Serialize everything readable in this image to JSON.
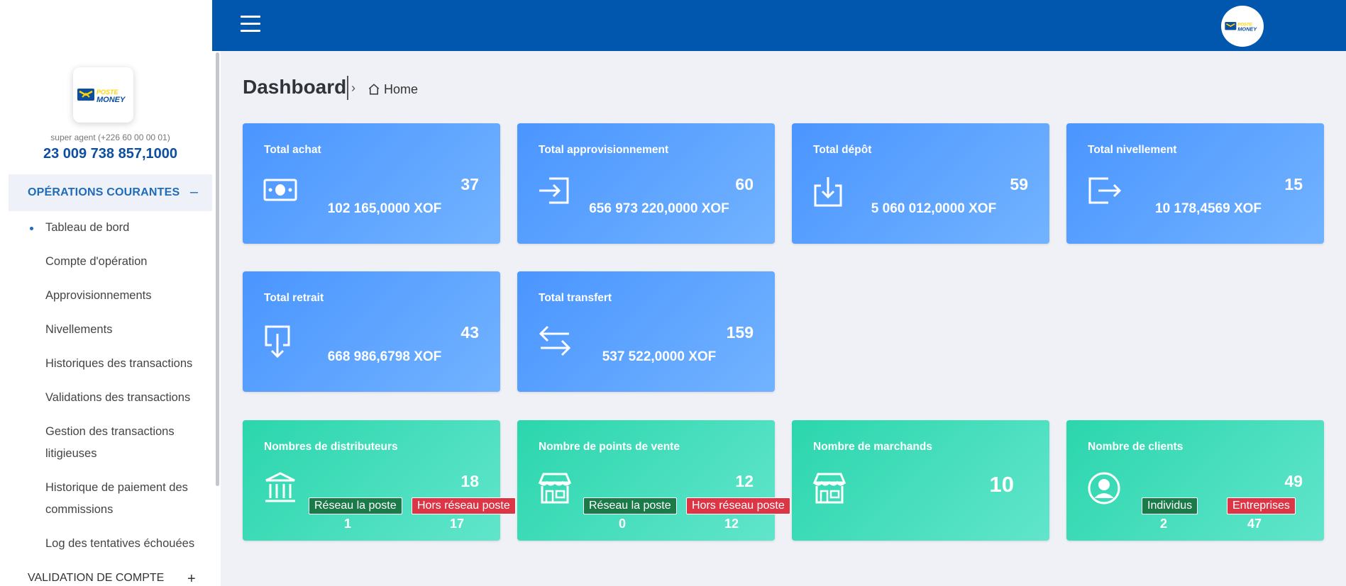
{
  "brand": {
    "logo_line1": "POSTE",
    "logo_line2": "MONEY",
    "color_primary": "#0057ad"
  },
  "sidebar": {
    "role": "super agent (+226 60 00 00 01)",
    "balance": "23 009 738 857,1000",
    "section1": {
      "label": "OPÉRATIONS COURANTES",
      "toggle": "–"
    },
    "items": [
      {
        "label": "Tableau de bord"
      },
      {
        "label": "Compte d'opération"
      },
      {
        "label": "Approvisionnements"
      },
      {
        "label": "Nivellements"
      },
      {
        "label": "Historiques des transactions"
      },
      {
        "label": "Validations des transactions"
      },
      {
        "label": "Gestion des transactions litigieuses"
      },
      {
        "label": "Historique de paiement des commissions"
      },
      {
        "label": "Log des tentatives échouées"
      }
    ],
    "section2": {
      "label": "VALIDATION DE COMPTE",
      "toggle": "+"
    }
  },
  "breadcrumb": {
    "title": "Dashboard",
    "home": "Home"
  },
  "cards": [
    {
      "title": "Total achat",
      "count": "37",
      "amount": "102 165,0000 XOF",
      "icon": "money-icon"
    },
    {
      "title": "Total approvisionnement",
      "count": "60",
      "amount": "656 973 220,0000 XOF",
      "icon": "login-icon"
    },
    {
      "title": "Total dépôt",
      "count": "59",
      "amount": "5 060 012,0000 XOF",
      "icon": "download-icon"
    },
    {
      "title": "Total nivellement",
      "count": "15",
      "amount": "10 178,4569 XOF",
      "icon": "logout-icon"
    },
    {
      "title": "Total retrait",
      "count": "43",
      "amount": "668 986,6798 XOF",
      "icon": "arrow-down-box-icon"
    },
    {
      "title": "Total transfert",
      "count": "159",
      "amount": "537 522,0000 XOF",
      "icon": "transfer-icon"
    }
  ],
  "stats": [
    {
      "title": "Nombres de distributeurs",
      "count": "18",
      "badge1": "Réseau la poste",
      "val1": "1",
      "badge2": "Hors réseau poste",
      "val2": "17",
      "icon": "bank-icon"
    },
    {
      "title": "Nombre de points de vente",
      "count": "12",
      "badge1": "Réseau la poste",
      "val1": "0",
      "badge2": "Hors réseau poste",
      "val2": "12",
      "icon": "store-icon"
    },
    {
      "title": "Nombre de marchands",
      "count": "10",
      "icon": "store-icon"
    },
    {
      "title": "Nombre de clients",
      "count": "49",
      "badge1": "Individus",
      "val1": "2",
      "badge2": "Entreprises",
      "val2": "47",
      "icon": "user-circle-icon"
    }
  ]
}
